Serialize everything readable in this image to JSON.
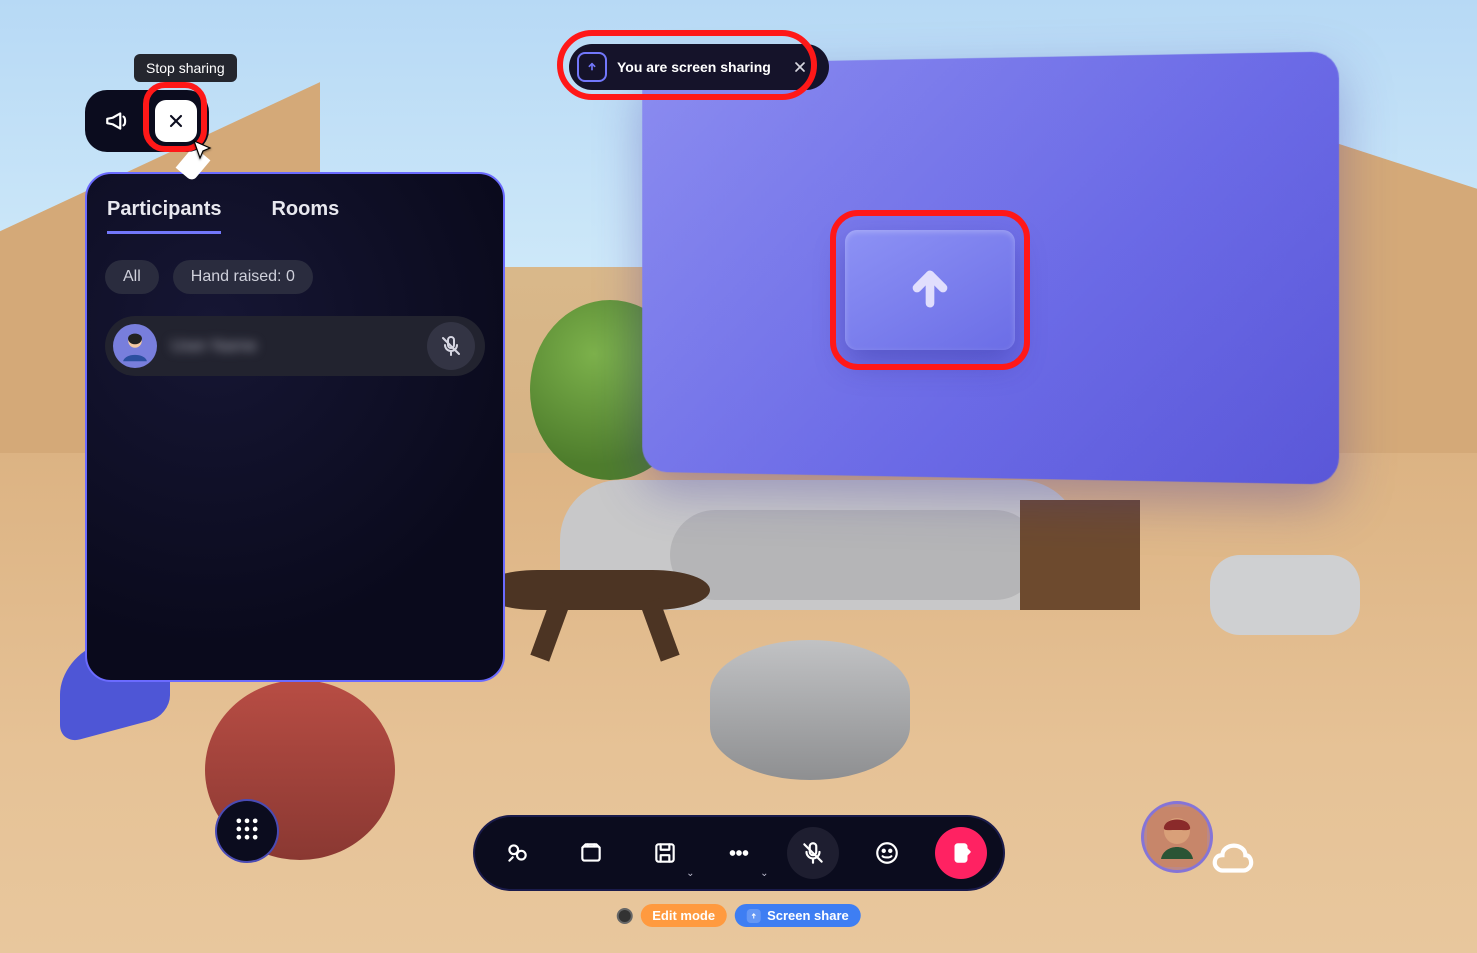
{
  "tooltip": {
    "stop_sharing": "Stop sharing"
  },
  "status": {
    "text": "You are screen sharing"
  },
  "panel": {
    "tabs": {
      "participants": "Participants",
      "rooms": "Rooms"
    },
    "filters": {
      "all": "All",
      "hand_raised": "Hand raised: 0"
    },
    "participants": [
      {
        "name": "User Name"
      }
    ]
  },
  "badges": {
    "edit_mode": "Edit mode",
    "screen_share": "Screen share"
  }
}
